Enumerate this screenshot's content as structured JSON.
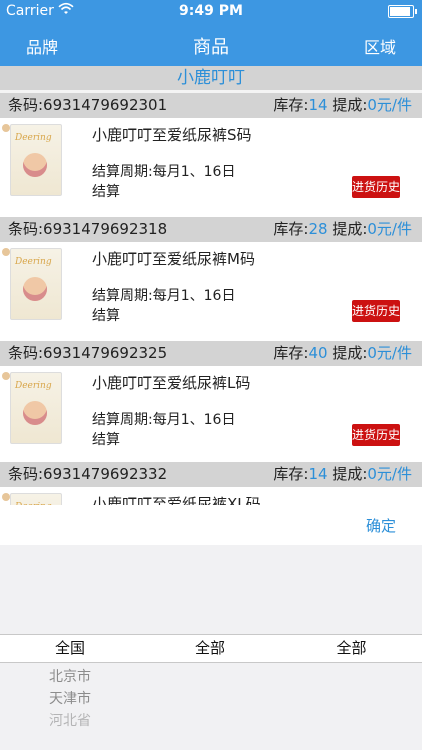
{
  "status": {
    "carrier": "Carrier",
    "time": "9:49 PM",
    "battery_level": 0.9
  },
  "nav": {
    "left": "品牌",
    "title": "商品",
    "right": "区域"
  },
  "brand": {
    "name": "小鹿叮叮"
  },
  "products": [
    {
      "barcode": "条码:6931479692301",
      "stock_label": "库存:",
      "stock_value": "14",
      "commission_label": "提成:",
      "commission_value": "0元/件",
      "name": "小鹿叮叮至爱纸尿裤S码",
      "cycle": "结算周期:每月1、16日结算",
      "history_button": "进货历史"
    },
    {
      "barcode": "条码:6931479692318",
      "stock_label": "库存:",
      "stock_value": "28",
      "commission_label": "提成:",
      "commission_value": "0元/件",
      "name": "小鹿叮叮至爱纸尿裤M码",
      "cycle": "结算周期:每月1、16日结算",
      "history_button": "进货历史"
    },
    {
      "barcode": "条码:6931479692325",
      "stock_label": "库存:",
      "stock_value": "40",
      "commission_label": "提成:",
      "commission_value": "0元/件",
      "name": "小鹿叮叮至爱纸尿裤L码",
      "cycle": "结算周期:每月1、16日结算",
      "history_button": "进货历史"
    },
    {
      "barcode": "条码:6931479692332",
      "stock_label": "库存:",
      "stock_value": "14",
      "commission_label": "提成:",
      "commission_value": "0元/件",
      "name": "小鹿叮叮至爱纸尿裤XL码"
    }
  ],
  "picker": {
    "confirm": "确定",
    "selected": [
      "全国",
      "全部",
      "全部"
    ],
    "options": [
      "北京市",
      "天津市",
      "河北省"
    ]
  },
  "colors": {
    "accent": "#3d97e2",
    "danger": "#cc1111",
    "blue_text": "#2c8fd8"
  },
  "icons": {
    "wifi": "wifi-icon",
    "battery": "battery-icon"
  }
}
